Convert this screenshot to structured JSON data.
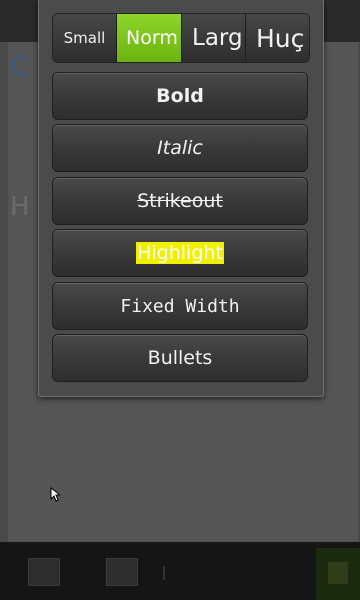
{
  "size_options": [
    {
      "label": "Small",
      "selected": false
    },
    {
      "label": "Norm",
      "selected": true
    },
    {
      "label": "Larg",
      "selected": false
    },
    {
      "label": "Huç",
      "selected": false
    }
  ],
  "format_buttons": {
    "bold": "Bold",
    "italic": "Italic",
    "strikeout": "Strikeout",
    "highlight": "Highlight",
    "fixed_width": "Fixed Width",
    "bullets": "Bullets"
  },
  "background_fragments": {
    "frag1": "C",
    "frag2": "H"
  },
  "colors": {
    "selected": "#7cc31a",
    "highlight": "#f0f000",
    "panel": "#4b4b4b"
  }
}
